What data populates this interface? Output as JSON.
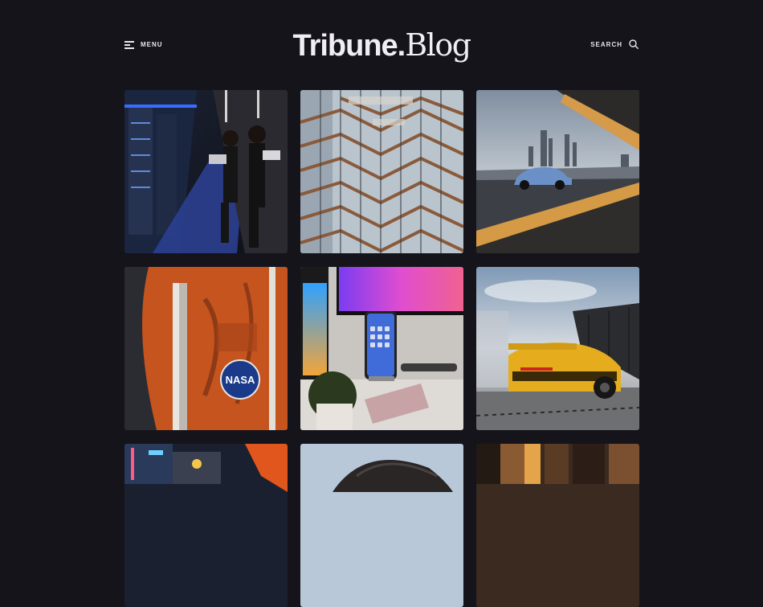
{
  "header": {
    "menu_label": "MENU",
    "logo_part1": "Tribune.",
    "logo_part2": "Blog",
    "search_label": "SEARCH"
  },
  "icons": {
    "menu": "hamburger-menu-icon",
    "search": "search-icon"
  },
  "colors": {
    "background": "#15141b",
    "text": "#eceaf2"
  },
  "posts": [
    {
      "subject": "women with laptops in server room"
    },
    {
      "subject": "honeycomb staircase structure"
    },
    {
      "subject": "blue sports car on bridge"
    },
    {
      "subject": "orange spacesuit with NASA patch"
    },
    {
      "subject": "smartphone on charging stand at desk"
    },
    {
      "subject": "yellow sports car rear view"
    },
    {
      "subject": "neon city street"
    },
    {
      "subject": "portrait with dark hair"
    },
    {
      "subject": "wooden interior"
    }
  ]
}
